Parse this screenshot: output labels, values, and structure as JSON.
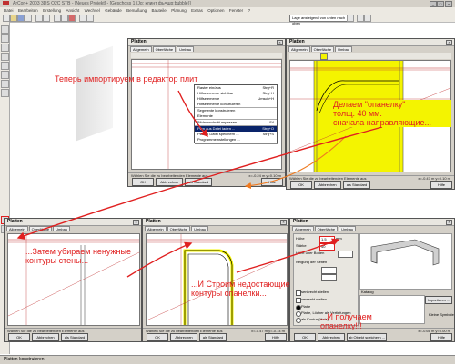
{
  "app": {
    "title": "ArCon+ 2003 3DS O2C STB - [Neues Projekt] - [Geschoss 1 (Jg: клинт фь=шр:bubble)]"
  },
  "menu": [
    "Datei",
    "Bearbeiten",
    "Erstellung",
    "Ansicht",
    "Wechsel",
    "Gebäude",
    "Bemaßung",
    "Bauteile",
    "Planung",
    "Extras",
    "Optionen",
    "Fenster",
    "?"
  ],
  "toolbar": {
    "combo_value": "Lage ansteigend von unten nach oben"
  },
  "status": {
    "text": "Platten konstruieren"
  },
  "panels": {
    "title": "Platten",
    "tabs": [
      "Allgemein",
      "Oberfläche",
      "Umbau"
    ],
    "ok": "OK",
    "cancel": "Abbrechen",
    "standard": "als Standard",
    "help": "Hilfe",
    "status_hint": "Wählen Sie die zu bearbeitenden Elemente aus",
    "coords": [
      "x=-0.24 m  y=0.10 m",
      "x=-0.47 m  y=0.10 m",
      "x=-0.47 m  y=-0.14 m",
      "x=-0.66 m  y=0.00 m"
    ]
  },
  "context_menu": {
    "items": [
      {
        "label": "Raster ein/aus",
        "shortcut": "Strg+R"
      },
      {
        "label": "Hilfselemente sichtbar",
        "shortcut": "Strg+H"
      },
      {
        "label": "Hilfselemente",
        "shortcut": "Umsch+H"
      },
      {
        "label": "Hilfselemente konstruieren",
        "shortcut": ""
      },
      {
        "label": "Segmente konstruieren",
        "shortcut": ""
      },
      {
        "label": "Elemente",
        "shortcut": ""
      },
      {
        "label": "Bildausschnitt anpassen",
        "shortcut": "F4"
      },
      {
        "label": "Plan aus Datei laden ...",
        "shortcut": "Strg+O"
      },
      {
        "label": "Plan in Datei speichern ...",
        "shortcut": "Strg+S"
      },
      {
        "label": "Programmeinstellungen ...",
        "shortcut": ""
      }
    ],
    "selected_index": 7
  },
  "form": {
    "height_label": "Höhe",
    "height_value": "1.5",
    "height_unit": "mm",
    "thickness_label": "Stärke",
    "thickness_value": "40",
    "boden_label": "Höhe über Boden",
    "neigung_label": "Neigung der Seiten",
    "opt1": "senkrecht stellen",
    "opt2": "versenkt stellen",
    "radio1": "Platte",
    "radio2": "Platte, Löcher als Vertiefungen",
    "radio3": "als Kontur (Holz)",
    "katalog_label": "Katalog",
    "importieren": "Importieren ...",
    "kleine_symbole": "Kleine Symbole",
    "ab_objekt": "ab Objekt speichern ..."
  },
  "annotations": {
    "a1": "Теперь импортируем в редактор плит",
    "a2": "Делаем \"опанелку\"\nтолщ. 40 мм.\nсначала направляющие...",
    "a3": "...Затем убираем ненужные\nконтуры стены...",
    "a4": "...И Строим недостающие\nконтуры опанелки...",
    "a5": "...И получаем опанелку!!!"
  },
  "colors": {
    "annotation": "#e02020",
    "highlight": "#f4f400",
    "selected_menu": "#0a246a"
  }
}
